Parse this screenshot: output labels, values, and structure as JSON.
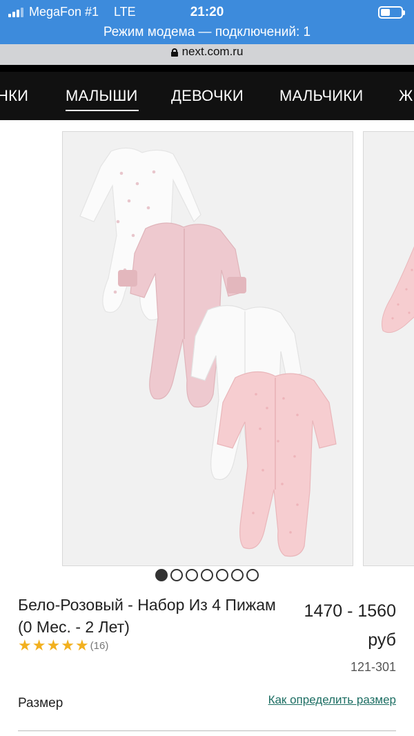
{
  "status_bar": {
    "carrier": "MegaFon #1",
    "network": "LTE",
    "time": "21:20",
    "battery_level": 0.45,
    "hotspot_text": "Режим модема — подключений: 1"
  },
  "browser": {
    "url": "next.com.ru"
  },
  "category_nav": {
    "items": [
      {
        "label": "НКИ",
        "active": false
      },
      {
        "label": "МАЛЫШИ",
        "active": true
      },
      {
        "label": "ДЕВОЧКИ",
        "active": false
      },
      {
        "label": "МАЛЬЧИКИ",
        "active": false
      },
      {
        "label": "Ж",
        "active": false
      }
    ]
  },
  "gallery": {
    "image_count": 7,
    "active_index": 0
  },
  "product": {
    "title": "Бело-Розовый - Набор Из 4 Пижам (0 Мес. - 2 Лет)",
    "price_range": "1470 - 1560",
    "currency": "руб",
    "rating": 5,
    "review_count": "(16)",
    "sku": "121-301"
  },
  "size": {
    "label": "Размер",
    "guide_link": "Как определить размер"
  },
  "colors": {
    "status_bar_bg": "#3d8bdc",
    "nav_bg": "#111111",
    "star": "#f2b01e",
    "link": "#1d6e63"
  }
}
